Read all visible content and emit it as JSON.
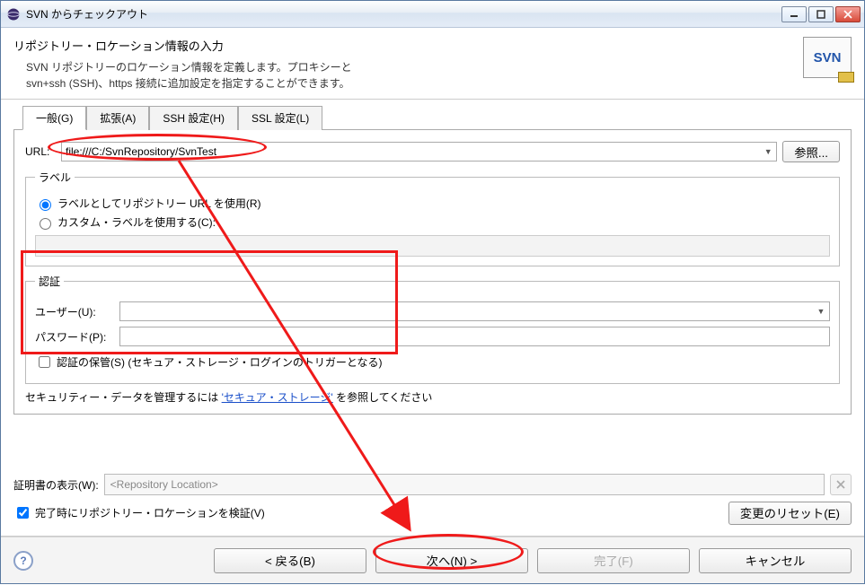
{
  "window": {
    "title": "SVN からチェックアウト"
  },
  "header": {
    "title": "リポジトリー・ロケーション情報の入力",
    "desc_line1": "SVN リポジトリーのロケーション情報を定義します。プロキシーと",
    "desc_line2": "svn+ssh (SSH)、https 接続に追加設定を指定することができます。",
    "badge": "SVN"
  },
  "tabs": {
    "general": "一般(G)",
    "ext": "拡張(A)",
    "ssh": "SSH 設定(H)",
    "ssl": "SSL 設定(L)"
  },
  "url": {
    "label": "URL:",
    "value": "file:///C:/SvnRepository/SvnTest",
    "browse": "参照..."
  },
  "label_group": {
    "legend": "ラベル",
    "use_url": "ラベルとしてリポジトリー URL を使用(R)",
    "custom": "カスタム・ラベルを使用する(C):"
  },
  "auth": {
    "legend": "認証",
    "user_label": "ユーザー(U):",
    "user_value": "",
    "pass_label": "パスワード(P):",
    "pass_value": "",
    "save_label": "認証の保管(S) (セキュア・ストレージ・ログインのトリガーとなる)",
    "note_pre": "セキュリティー・データを管理するには ",
    "note_link": "'セキュア・ストレージ'",
    "note_post": " を参照してください"
  },
  "cert": {
    "label": "証明書の表示(W):",
    "placeholder": "<Repository Location>"
  },
  "validate": {
    "checkbox": "完了時にリポジトリー・ロケーションを検証(V)",
    "reset": "変更のリセット(E)"
  },
  "buttons": {
    "back": "< 戻る(B)",
    "next": "次へ(N) >",
    "finish": "完了(F)",
    "cancel": "キャンセル"
  }
}
